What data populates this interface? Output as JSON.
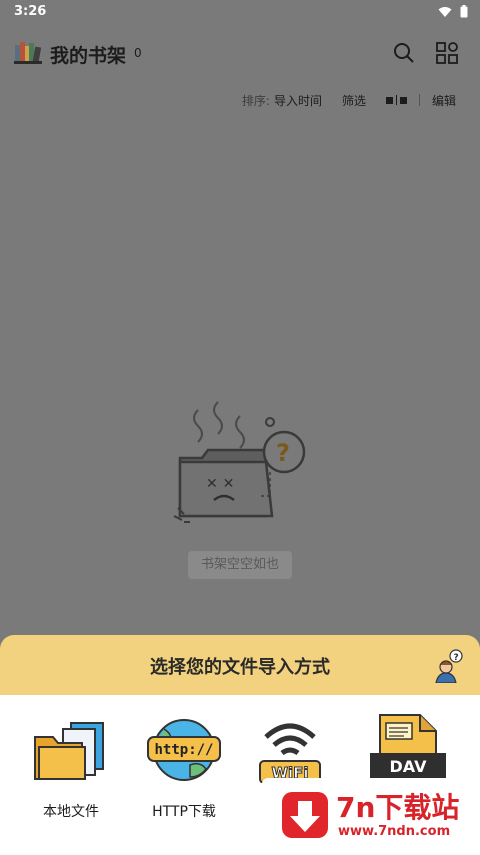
{
  "status_bar": {
    "time": "3:26"
  },
  "app_bar": {
    "title": "我的书架",
    "book_count": "0"
  },
  "toolbar": {
    "sort_label": "排序:",
    "sort_value": "导入时间",
    "filter": "筛选",
    "edit": "编辑"
  },
  "empty_state": {
    "message": "书架空空如也"
  },
  "sheet": {
    "title": "选择您的文件导入方式",
    "options": [
      {
        "label": "本地文件",
        "icon": "folder-files-icon"
      },
      {
        "label": "HTTP下载",
        "icon": "http-globe-icon"
      },
      {
        "label": "",
        "icon": "wifi-icon"
      },
      {
        "label": "",
        "icon": "dav-document-icon"
      }
    ]
  },
  "watermark": {
    "brand": "7n下载站",
    "url": "www.7ndn.com"
  },
  "colors": {
    "overlay": "#7a7a7a",
    "sheet_header": "#f2d27e",
    "sheet_body": "#ffffff",
    "watermark_red": "#d8232a"
  }
}
